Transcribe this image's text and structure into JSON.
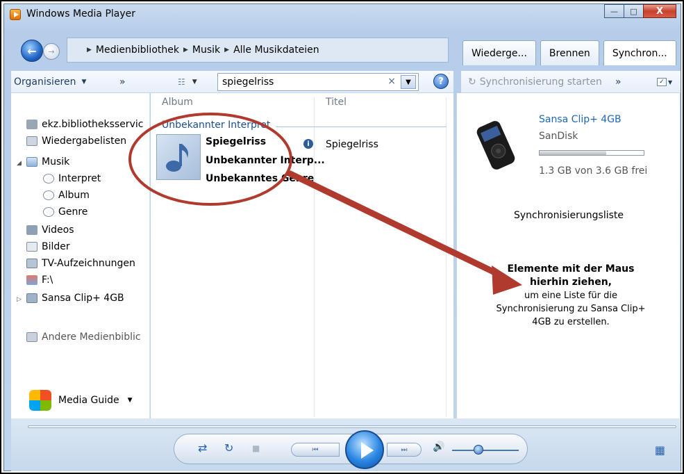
{
  "window": {
    "title": "Windows Media Player",
    "min_glyph": "—",
    "max_glyph": "□",
    "close_glyph": "X"
  },
  "breadcrumb": {
    "items": [
      "Medienbibliothek",
      "Musik",
      "Alle Musikdateien"
    ]
  },
  "tabs": [
    "Wiederge...",
    "Brennen",
    "Synchron..."
  ],
  "toolbar": {
    "organize_label": "Organisieren",
    "more": "»",
    "search_value": "spiegelriss",
    "clear_glyph": "×",
    "help_glyph": "?"
  },
  "sync_toolbar": {
    "start_label": "Synchronisierung starten",
    "more": "»"
  },
  "nav": {
    "items": [
      {
        "label": "ekz.bibliotheksservic",
        "icon": "library-icon"
      },
      {
        "label": "Wiedergabelisten",
        "icon": "playlist-icon"
      },
      {
        "label": "Musik",
        "icon": "music-icon"
      },
      {
        "label": "Interpret",
        "icon": "artist-icon"
      },
      {
        "label": "Album",
        "icon": "album-icon"
      },
      {
        "label": "Genre",
        "icon": "genre-icon"
      },
      {
        "label": "Videos",
        "icon": "video-icon"
      },
      {
        "label": "Bilder",
        "icon": "picture-icon"
      },
      {
        "label": "TV-Aufzeichnungen",
        "icon": "tv-icon"
      },
      {
        "label": "F:\\",
        "icon": "drive-icon"
      },
      {
        "label": "Sansa Clip+ 4GB",
        "icon": "device-icon"
      },
      {
        "label": "Andere Medienbiblic",
        "icon": "other-libraries-icon"
      }
    ],
    "media_guide": "Media Guide"
  },
  "content": {
    "columns": [
      "Album",
      "Titel"
    ],
    "group": "Unbekannter Interpret",
    "album_lines": [
      "Spiegelriss",
      "Unbekannter Interp...",
      "Unbekanntes Genre"
    ],
    "title": "Spiegelriss",
    "info_glyph": "i"
  },
  "device": {
    "name": "Sansa Clip+ 4GB",
    "brand": "SanDisk",
    "usage_fraction": 0.64,
    "free_text": "1.3 GB von 3.6 GB frei"
  },
  "sync_list": {
    "title": "Synchronisierungsliste",
    "hint_bold": "Elemente mit der Maus hierhin ziehen,",
    "hint_text": "um eine Liste für die Synchronisierung zu Sansa Clip+ 4GB zu erstellen."
  },
  "player": {
    "volume_fraction": 0.4
  },
  "colors": {
    "accent": "#1e66b5",
    "annotation": "#b03a2e"
  }
}
